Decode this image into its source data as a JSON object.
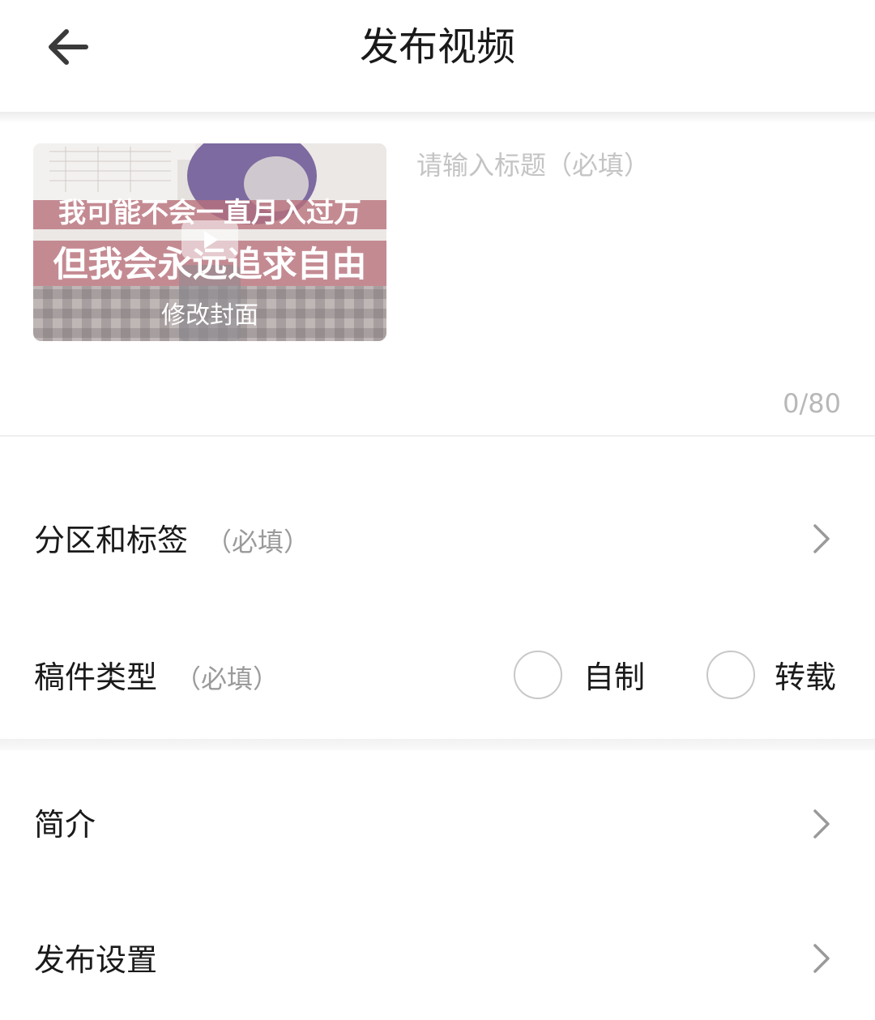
{
  "header": {
    "title": "发布视频",
    "back_icon": "arrow-left-icon"
  },
  "cover": {
    "overlay_line1": "我可能不会一直月入过万",
    "overlay_line2": "但我会永远追求自由",
    "edit_label": "修改封面",
    "play_icon": "play-icon"
  },
  "title_field": {
    "value": "",
    "placeholder": "请输入标题（必填）",
    "counter": "0/80"
  },
  "rows": {
    "category": {
      "label": "分区和标签",
      "required": "（必填）",
      "icon": "chevron-right-icon"
    },
    "type": {
      "label": "稿件类型",
      "required": "（必填）",
      "options": [
        {
          "label": "自制",
          "selected": false
        },
        {
          "label": "转载",
          "selected": false
        }
      ]
    },
    "intro": {
      "label": "简介",
      "icon": "chevron-right-icon"
    },
    "publish_settings": {
      "label": "发布设置",
      "icon": "chevron-right-icon"
    }
  },
  "colors": {
    "text_primary": "#1a1a1a",
    "text_secondary": "#9a9a9a",
    "placeholder": "#c4c4c4",
    "divider": "#efefef",
    "cover_banner": "#b9707a"
  }
}
